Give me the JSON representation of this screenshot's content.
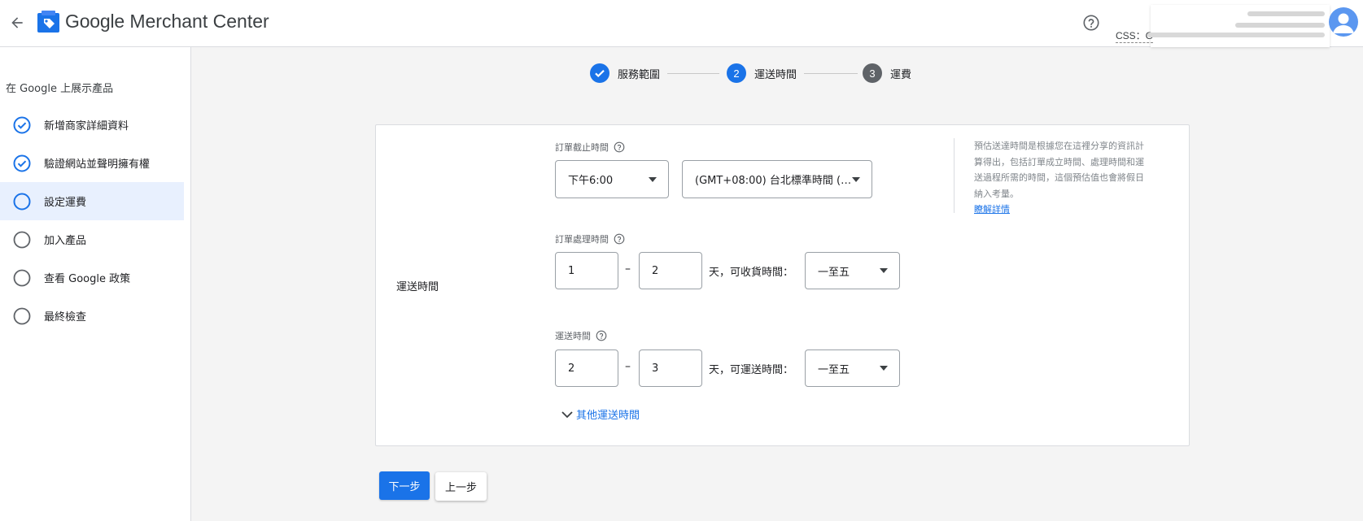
{
  "header": {
    "app_title_google": "Google",
    "app_title_rest": " Merchant Center",
    "css_label": "CSS：G"
  },
  "sidebar": {
    "heading": "在 Google 上展示產品",
    "items": [
      {
        "label": "新增商家詳細資料",
        "status": "done"
      },
      {
        "label": "驗證網站並聲明擁有權",
        "status": "done"
      },
      {
        "label": "設定運費",
        "status": "current"
      },
      {
        "label": "加入產品",
        "status": "todo"
      },
      {
        "label": "查看 Google 政策",
        "status": "todo"
      },
      {
        "label": "最終檢查",
        "status": "todo"
      }
    ]
  },
  "stepper": {
    "steps": [
      {
        "number": "",
        "label": "服務範圍",
        "state": "done"
      },
      {
        "number": "2",
        "label": "運送時間",
        "state": "active"
      },
      {
        "number": "3",
        "label": "運費",
        "state": "upcoming"
      }
    ]
  },
  "form": {
    "row_label": "運送時間",
    "cutoff": {
      "label": "訂單截止時間",
      "time_value": "下午6:00",
      "timezone_value": "(GMT+08:00) 台北標準時間 (…"
    },
    "handling": {
      "label": "訂單處理時間",
      "min": "1",
      "dash": "–",
      "max": "2",
      "suffix": "天，可收貨時間：",
      "days_value": "一至五"
    },
    "transit": {
      "label": "運送時間",
      "min": "2",
      "dash": "–",
      "max": "3",
      "suffix": "天，可運送時間：",
      "days_value": "一至五"
    },
    "info_text": "預估送達時間是根據您在這裡分享的資訊計算得出，包括訂單成立時間、處理時間和運送過程所需的時間，這個預估值也會將假日納入考量。",
    "learn_more": "瞭解詳情",
    "more_times_link": "其他運送時間"
  },
  "buttons": {
    "next": "下一步",
    "back": "上一步"
  },
  "colors": {
    "primary": "#1a73e8",
    "step_upcoming": "#5f6368",
    "active_bg": "#e8f0fe"
  }
}
